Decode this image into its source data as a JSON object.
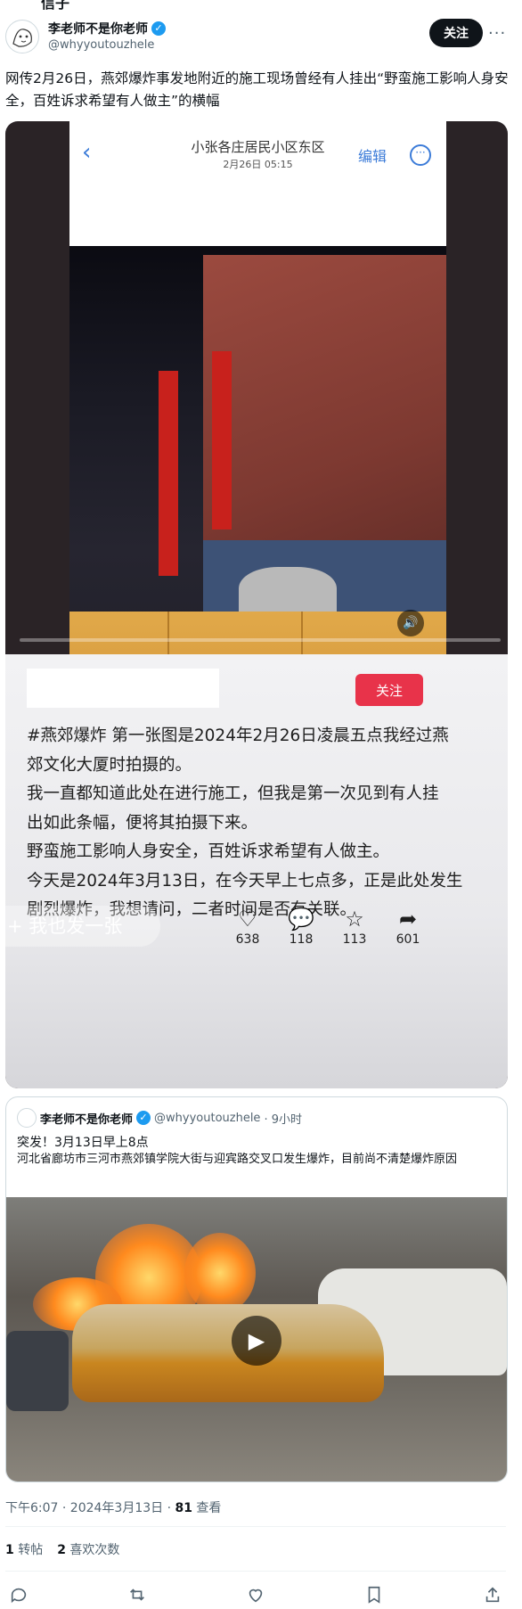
{
  "header": {
    "top_cut_text": "信子",
    "author_name": "李老师不是你老师",
    "author_handle": "@whyyoutouzhele",
    "follow_label": "关注",
    "more_label": "···"
  },
  "tweet": {
    "text": "网传2月26日，燕郊爆炸事发地附近的施工现场曾经有人挂出“野蛮施工影响人身安全，百姓诉求希望有人做主”的横幅"
  },
  "video": {
    "phone_header": {
      "back": "‹",
      "title": "小张各庄居民小区东区",
      "subtitle": "2月26日 05:15",
      "edit": "编辑",
      "more": "···"
    },
    "follow_label": "关注",
    "caption_lines": [
      "#燕郊爆炸 第一张图是2024年2月26日凌晨五点我经过燕",
      "郊文化大厦时拍摄的。",
      "我一直都知道此处在进行施工，但我是第一次见到有人挂",
      "出如此条幅，便将其拍摄下来。",
      "野蛮施工影响人身安全，百姓诉求希望有人做主。",
      "今天是2024年3月13日，在今天早上七点多，正是此处发生",
      "剧烈爆炸，我想请问，二者时间是否有关联。"
    ],
    "overlay_text": "+ 我也发一张",
    "likes": "638",
    "comments": "118",
    "favorites": "113",
    "shares": "601"
  },
  "quote": {
    "author_name": "李老师不是你老师",
    "author_handle": "@whyyoutouzhele",
    "time_ago": "· 9小时",
    "line1": "突发！3月13日早上8点",
    "line2": "河北省廊坊市三河市燕郊镇学院大街与迎宾路交叉口发生爆炸，目前尚不清楚爆炸原因"
  },
  "meta": {
    "timestamp": "下午6:07 · 2024年3月13日 · ",
    "views_count": "81",
    "views_label": " 查看",
    "retweets_count": "1",
    "retweets_label": " 转帖",
    "likes_count": "2",
    "likes_label": " 喜欢次数"
  },
  "colors": {
    "follow_bg": "#0f1419",
    "verified": "#1d9bf0",
    "video_follow": "#e8334a"
  }
}
